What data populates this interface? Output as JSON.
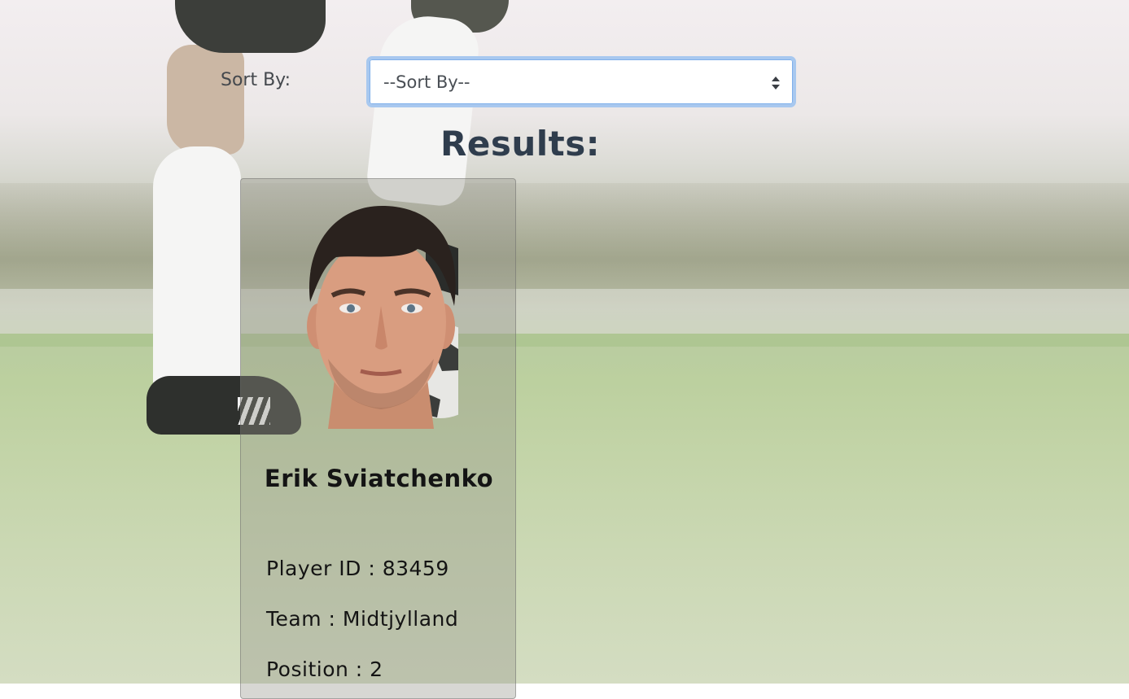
{
  "sort": {
    "label": "Sort By:",
    "selected": "--Sort By--"
  },
  "results": {
    "title": "Results:"
  },
  "players": [
    {
      "name": "Erik Sviatchenko",
      "player_id_label": "Player ID",
      "player_id": "83459",
      "team_label": "Team",
      "team": "Midtjylland",
      "position_label": "Position",
      "position": "2"
    }
  ],
  "colors": {
    "title": "#2f3d4d",
    "select_focus_border": "#a8c8ef",
    "text": "#141414"
  }
}
